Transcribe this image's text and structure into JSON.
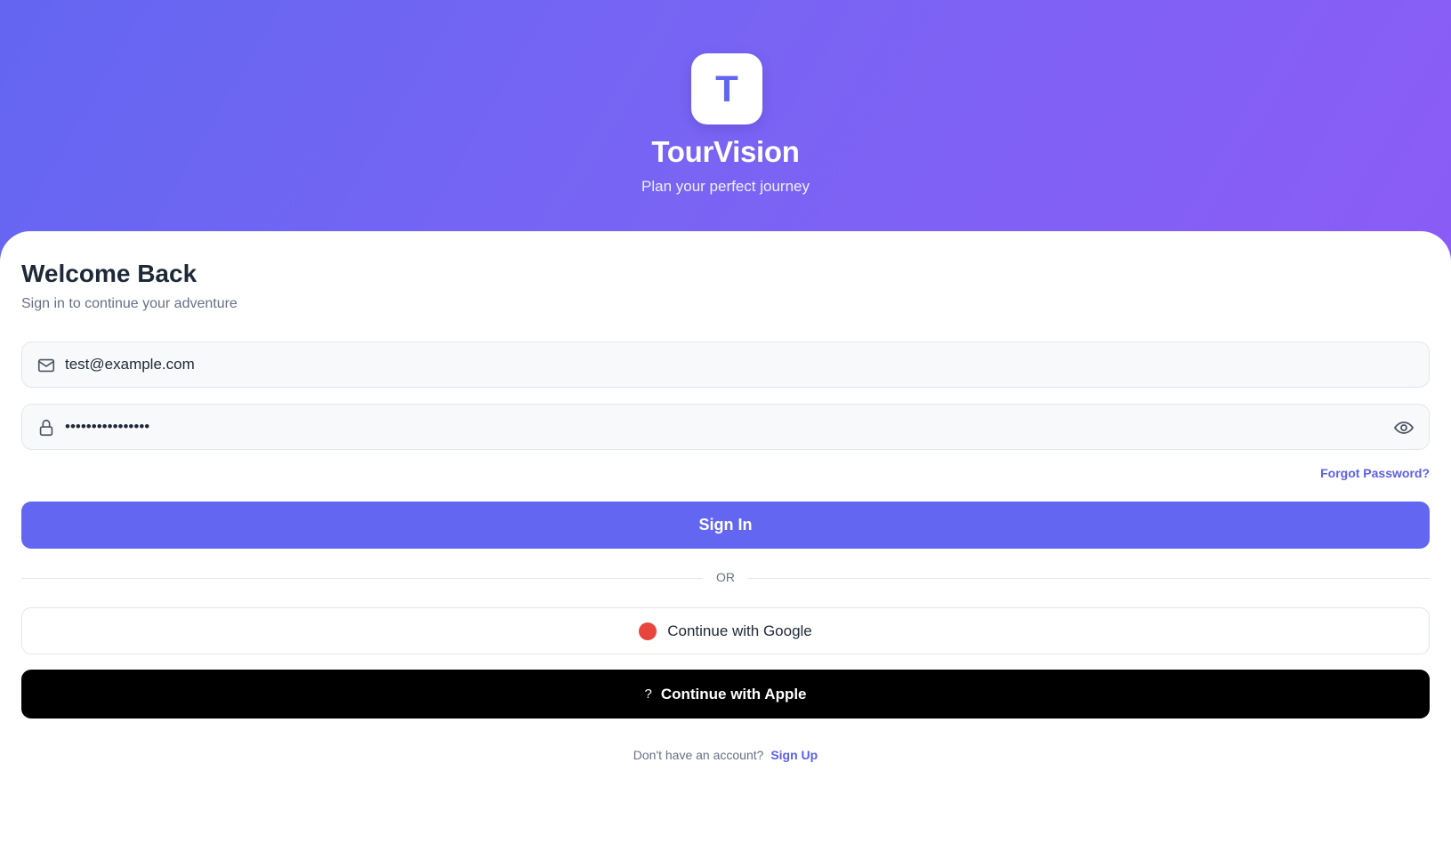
{
  "header": {
    "logo_letter": "T",
    "app_name": "TourVision",
    "tagline": "Plan your perfect journey"
  },
  "form": {
    "title": "Welcome Back",
    "subtitle": "Sign in to continue your adventure",
    "email": {
      "icon": "mail-icon",
      "value": "test@example.com"
    },
    "password": {
      "icon": "lock-icon",
      "value": "••••••••••••••••",
      "toggle_icon": "eye-icon"
    },
    "forgot_password_label": "Forgot Password?",
    "sign_in_label": "Sign In",
    "divider_label": "OR",
    "google_label": "Continue with Google",
    "apple_icon_glyph": "?",
    "apple_label": "Continue with Apple",
    "signup_prompt": "Don't have an account?",
    "signup_link_label": "Sign Up"
  },
  "colors": {
    "primary": "#6366f1",
    "gradient_end": "#8b5cf6",
    "google_dot": "#e8453c",
    "apple_button": "#000000",
    "heading": "#1e2937",
    "muted_text": "#667085"
  }
}
